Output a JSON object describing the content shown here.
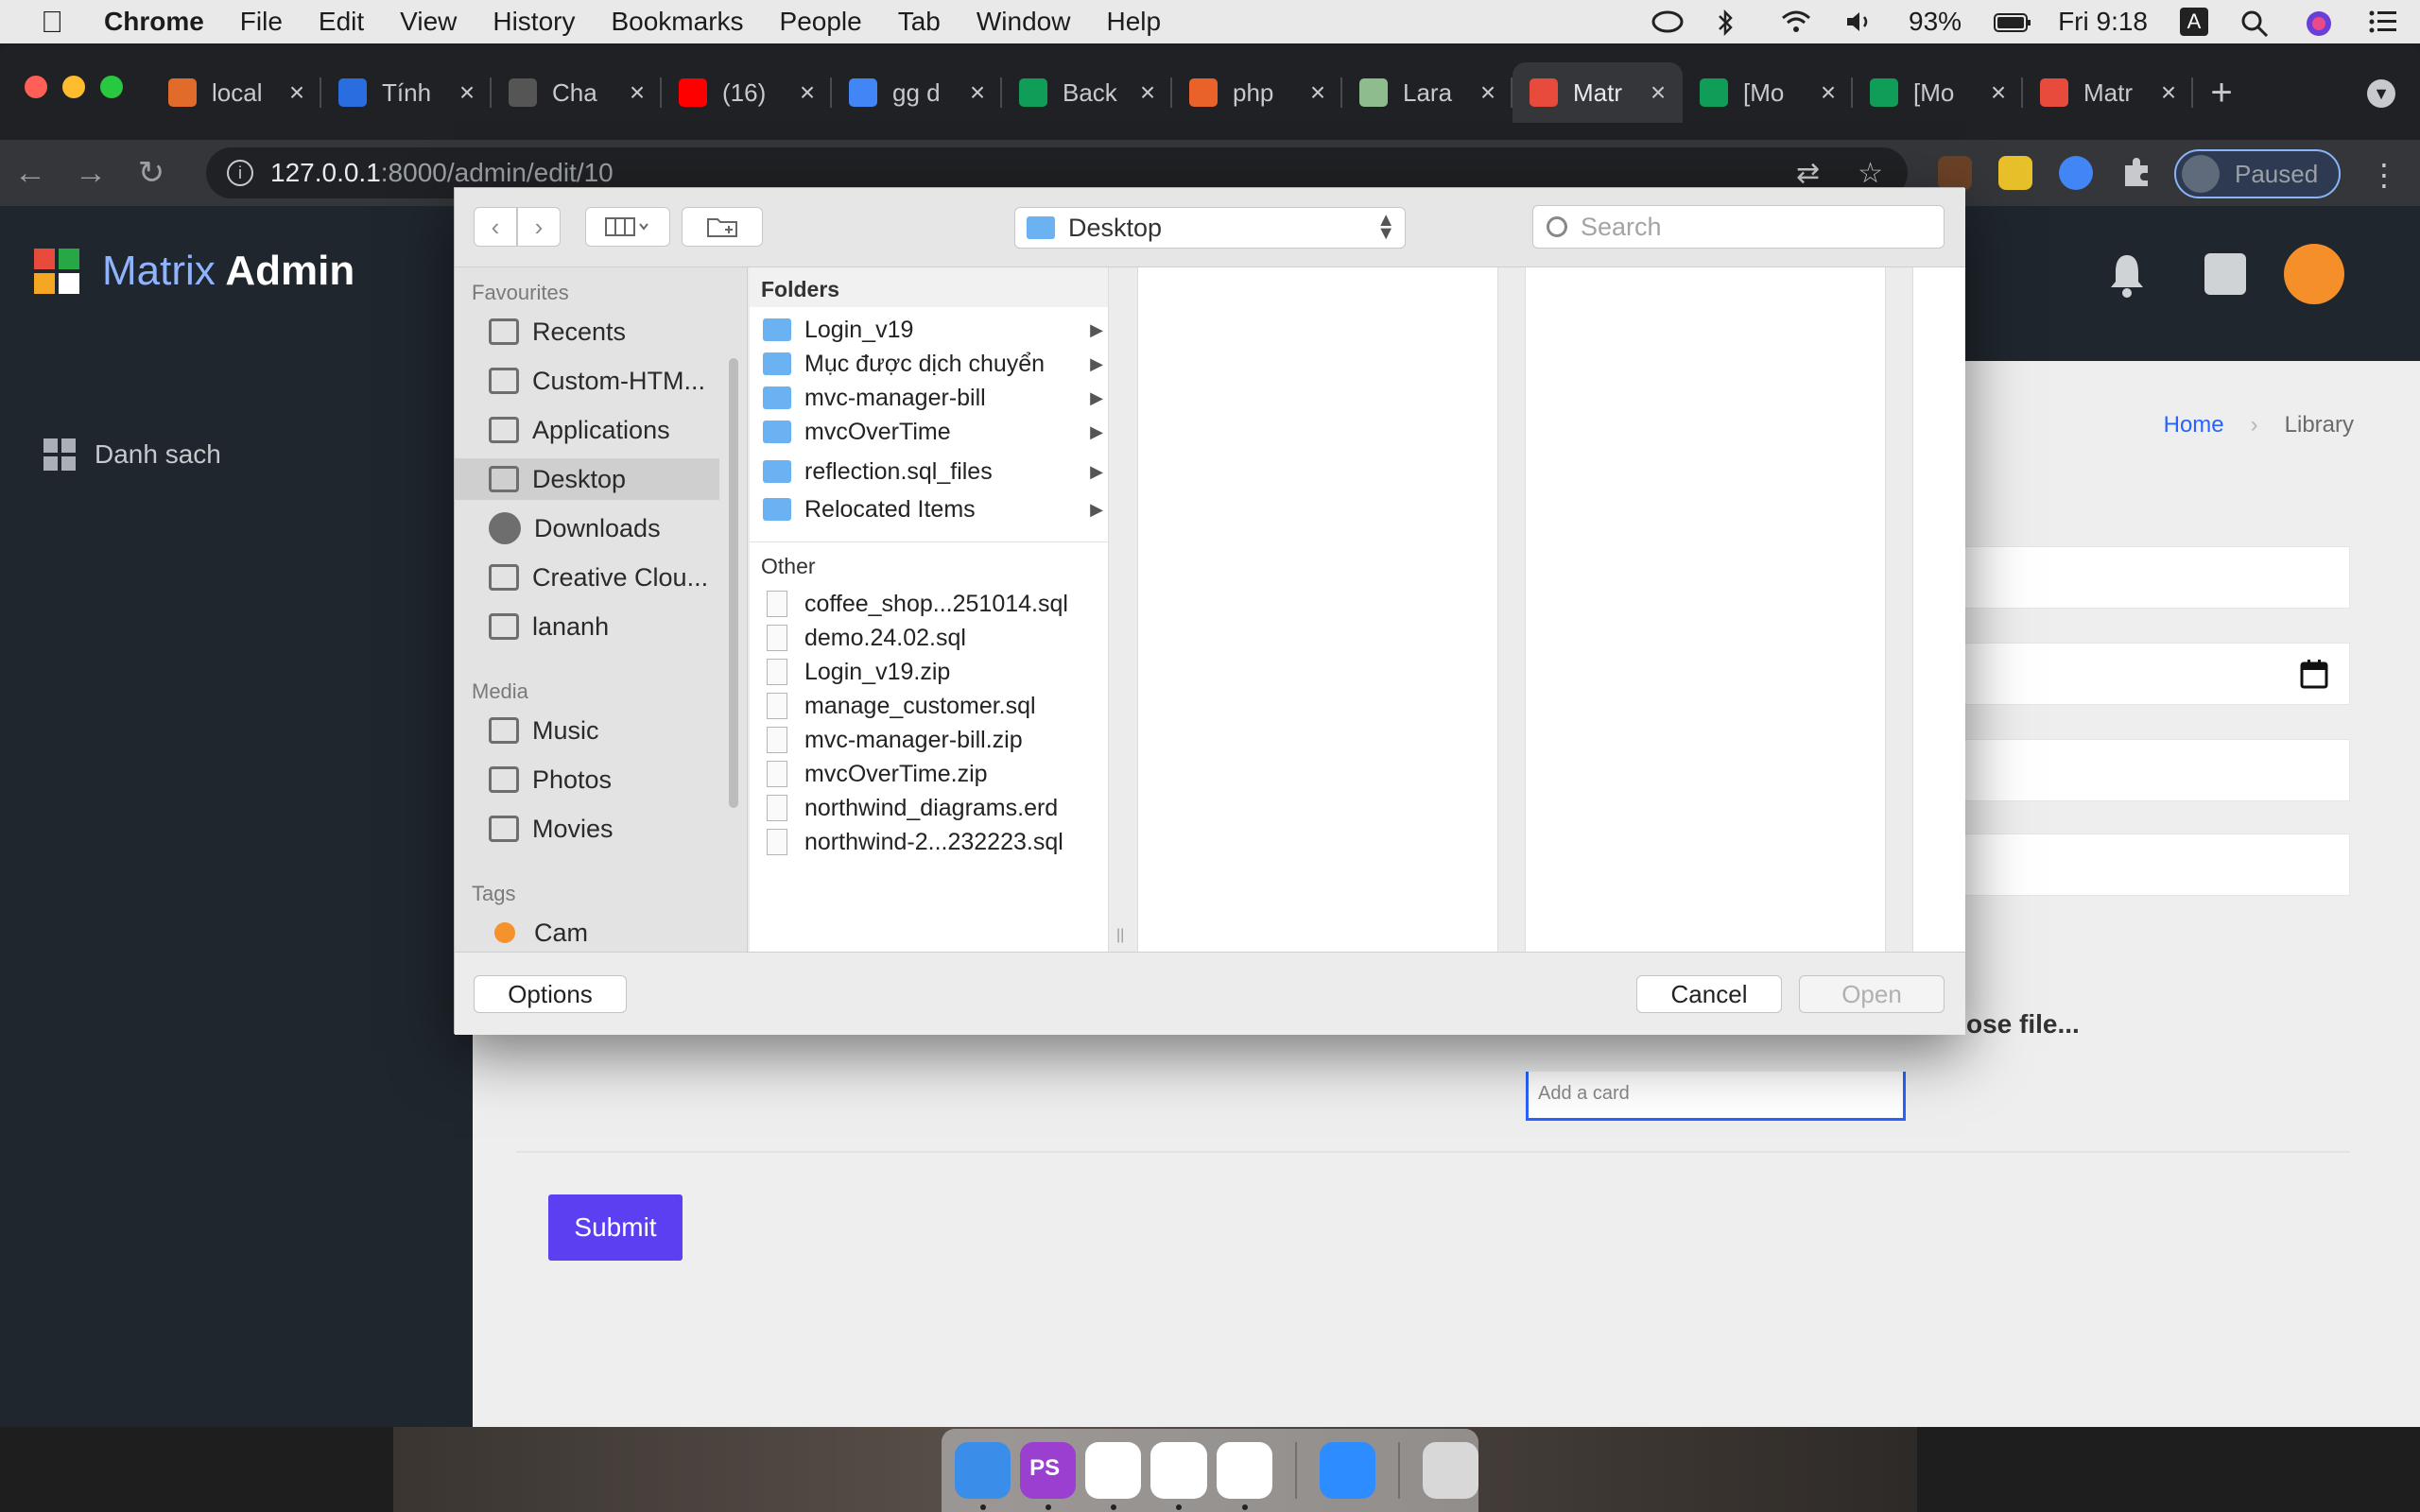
{
  "menubar": {
    "app": "Chrome",
    "items": [
      "File",
      "Edit",
      "View",
      "History",
      "Bookmarks",
      "People",
      "Tab",
      "Window",
      "Help"
    ],
    "battery": "93%",
    "clock": "Fri 9:18",
    "input_badge": "A"
  },
  "browser": {
    "tabs": [
      {
        "title": "local",
        "color": "#e06b2a"
      },
      {
        "title": "Tính",
        "color": "#2a6de0"
      },
      {
        "title": "Cha",
        "color": "#555555"
      },
      {
        "title": "(16)",
        "color": "#ff0000"
      },
      {
        "title": "gg d",
        "color": "#4285f4"
      },
      {
        "title": "Back",
        "color": "#0f9d58"
      },
      {
        "title": "php",
        "color": "#e8622a"
      },
      {
        "title": "Lara",
        "color": "#8fbc8f"
      },
      {
        "title": "Matr",
        "color": "#e84a3c",
        "active": true
      },
      {
        "title": "[Mo",
        "color": "#0f9d58"
      },
      {
        "title": "[Mo",
        "color": "#0f9d58"
      },
      {
        "title": "Matr",
        "color": "#e84a3c"
      }
    ],
    "url_host": "127.0.0.1",
    "url_path": ":8000/admin/edit/10",
    "profile_label": "Paused"
  },
  "app": {
    "logo_prefix": "Ma",
    "logo_mid": "trix",
    "logo_suffix": " Admin",
    "sidebar_item": "Danh sach",
    "breadcrumb_home": "Home",
    "breadcrumb_current": "Library",
    "choose_file": "ose file...",
    "add_card_placeholder": "Add a card",
    "submit_label": "Submit"
  },
  "dialog": {
    "location": "Desktop",
    "search_placeholder": "Search",
    "favourites_title": "Favourites",
    "favourites": [
      "Recents",
      "Custom-HTM...",
      "Applications",
      "Desktop",
      "Downloads",
      "Creative Clou...",
      "lananh"
    ],
    "media_title": "Media",
    "media": [
      "Music",
      "Photos",
      "Movies"
    ],
    "tags_title": "Tags",
    "tags": [
      "Cam"
    ],
    "folders_title": "Folders",
    "folders": [
      "Login_v19",
      "Mục được dịch chuyển",
      "mvc-manager-bill",
      "mvcOverTime",
      "reflection.sql_files",
      "Relocated Items"
    ],
    "other_title": "Other",
    "files": [
      "coffee_shop...251014.sql",
      "demo.24.02.sql",
      "Login_v19.zip",
      "manage_customer.sql",
      "mvc-manager-bill.zip",
      "mvcOverTime.zip",
      "northwind_diagrams.erd",
      "northwind-2...232223.sql"
    ],
    "options_label": "Options",
    "cancel_label": "Cancel",
    "open_label": "Open"
  },
  "dock": {
    "apps": [
      {
        "name": "finder",
        "color": "#3a8de8"
      },
      {
        "name": "phpstorm",
        "color": "#9b3fd0",
        "label": "PS"
      },
      {
        "name": "slack",
        "color": "#ffffff"
      },
      {
        "name": "sourcetree",
        "color": "#ffffff"
      },
      {
        "name": "chrome",
        "color": "#ffffff"
      },
      {
        "name": "zoom",
        "color": "#2d8cff"
      },
      {
        "name": "trash",
        "color": "#d8d8d8"
      }
    ]
  }
}
